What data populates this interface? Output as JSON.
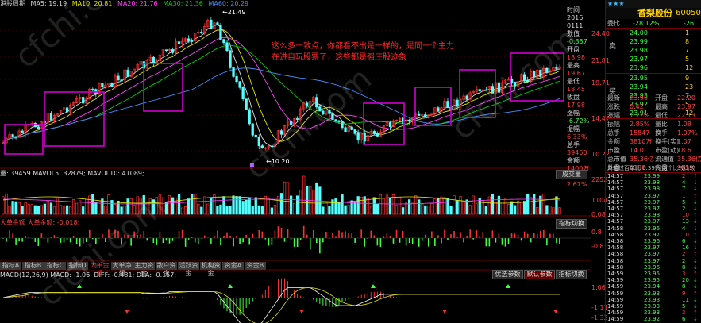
{
  "ma_legend": {
    "title": "港股周期",
    "items": [
      {
        "label": "MA5: 19.19",
        "color": "#dddddd"
      },
      {
        "label": "MA10: 20.81",
        "color": "#e8e800"
      },
      {
        "label": "MA20: 21.76",
        "color": "#ff40ff"
      },
      {
        "label": "MA30: 21.36",
        "color": "#00d000"
      },
      {
        "label": "MA60: 20.29",
        "color": "#4090ff"
      }
    ]
  },
  "price_labels": {
    "high": "21.49",
    "low": "10.20"
  },
  "annotation": {
    "line1": "这么多一致点，你都看不出是一样的，是同一个主力",
    "line2": "在进自玩股票了，这些都是强庄股迹象"
  },
  "watermark": "cfchi.com",
  "axis": {
    "price": [
      "24.40",
      "21.81",
      "19.71",
      "14.47",
      "10.22"
    ],
    "vol": [
      "2252",
      "1104",
      "",
      "0.08"
    ],
    "money": [
      "0.8",
      "-0.8"
    ],
    "macd": [
      "1.06",
      "-1.11",
      "-1.32"
    ]
  },
  "info_panel": {
    "items": [
      {
        "label": "时间",
        "value": "2016"
      },
      {
        "label": "",
        "value": "0111"
      },
      {
        "label": "数值",
        "value": "-0.357"
      },
      {
        "label": "开盘",
        "value": "18.98"
      },
      {
        "label": "最高",
        "value": "19.67"
      },
      {
        "label": "最低",
        "value": "18.45"
      },
      {
        "label": "收盘",
        "value": "17.98"
      },
      {
        "label": "涨幅",
        "value": "-6.72%"
      },
      {
        "label": "振幅",
        "value": "6.33%"
      },
      {
        "label": "总手",
        "value": "39460"
      },
      {
        "label": "金额",
        "value": "1400万"
      },
      {
        "label": "换手",
        "value": "2.67%"
      }
    ]
  },
  "vol_legend": {
    "text": "量: 39459  MAVOL5: 32879;  MAVOL10: 41089;",
    "btn": "成交量"
  },
  "money_legend": {
    "text": "大单金额  大单金额: -0.018;",
    "btn": "指标切换"
  },
  "macd_legend": {
    "text": "MACD(12,26,9)  MACD: -1.06;  DIFF: -0.481;  DEA: -0.157;"
  },
  "macd_buttons": [
    "优选参数",
    "默认参数",
    "指标切换"
  ],
  "tabs": [
    "指标A",
    "指标B",
    "指标C",
    "指标D",
    "大单金额",
    "大单净额",
    "主力资金",
    "散户资金",
    "活跃资金",
    "机构资金",
    "资金A",
    "资金B"
  ],
  "right_panel": {
    "stars": "★★★",
    "stock_name": "香梨股份",
    "stock_code": "600506",
    "committee": {
      "label": "委比",
      "value": "-28.12%",
      "diff": "-26"
    },
    "asks": [
      {
        "price": "24.00",
        "vol": "1"
      },
      {
        "price": "23.99",
        "vol": "8"
      },
      {
        "price": "23.98",
        "vol": "7"
      },
      {
        "price": "23.97",
        "vol": "5"
      },
      {
        "price": "23.96",
        "vol": "12"
      }
    ],
    "sell_label": "卖",
    "buy_label": "买",
    "bids": [
      {
        "price": "23.95",
        "vol": "9"
      },
      {
        "price": "23.94",
        "vol": "23"
      },
      {
        "price": "23.93",
        "vol": "7"
      },
      {
        "price": "23.92",
        "vol": "5"
      },
      {
        "price": "23.91",
        "vol": "12"
      }
    ],
    "stats": [
      {
        "l": "最新",
        "v": "23.96",
        "l2": "开盘",
        "v2": "22.20"
      },
      {
        "l": "涨跌",
        "v": "0.42",
        "l2": "最高",
        "v2": "23.97"
      },
      {
        "l": "涨幅",
        "v": "1.72%",
        "l2": "最低",
        "v2": "22.13"
      },
      {
        "l": "振幅",
        "v": "2.85%",
        "l2": "量比",
        "v2": "1.08"
      },
      {
        "l": "总手",
        "v": "15847",
        "l2": "换手",
        "v2": "1.07%"
      },
      {
        "l": "金额",
        "v": "3810万",
        "l2": "换手(实)",
        "v2": "1.07"
      },
      {
        "l": "市盈",
        "v": "14.0",
        "l2": "市盈(动)",
        "v2": "18.6"
      },
      {
        "l": "总市值",
        "v": "35.36亿",
        "l2": "流通值",
        "v2": "35.36亿"
      },
      {
        "l": "外盘",
        "v": "6188",
        "l2": "内盘",
        "v2": "9659"
      }
    ],
    "ticks_header": "单笔过百单比  0.39%  两个比较比较",
    "ticks": [
      {
        "t": "14:57",
        "p": "23.99",
        "v": "2"
      },
      {
        "t": "14:57",
        "p": "23.98",
        "v": "4"
      },
      {
        "t": "14:57",
        "p": "23.98",
        "v": "7"
      },
      {
        "t": "14:57",
        "p": "23.97",
        "v": "1"
      },
      {
        "t": "14:57",
        "p": "23.97",
        "v": "5"
      },
      {
        "t": "14:57",
        "p": "23.97",
        "v": "2"
      },
      {
        "t": "14:57",
        "p": "23.98",
        "v": "10"
      },
      {
        "t": "14:57",
        "p": "23.97",
        "v": "13"
      },
      {
        "t": "14:58",
        "p": "23.96",
        "v": "4"
      },
      {
        "t": "14:58",
        "p": "23.97",
        "v": "10"
      },
      {
        "t": "14:58",
        "p": "23.96",
        "v": "6"
      },
      {
        "t": "14:58",
        "p": "23.97",
        "v": "16"
      },
      {
        "t": "14:58",
        "p": "23.97",
        "v": "2"
      },
      {
        "t": "14:58",
        "p": "23.97",
        "v": "2"
      },
      {
        "t": "14:58",
        "p": "23.96",
        "v": "8"
      },
      {
        "t": "14:59",
        "p": "23.95",
        "v": "3"
      },
      {
        "t": "14:59",
        "p": "23.95",
        "v": "20"
      },
      {
        "t": "14:59",
        "p": "23.94",
        "v": "8"
      },
      {
        "t": "14:59",
        "p": "23.93",
        "v": "9"
      },
      {
        "t": "14:59",
        "p": "23.93",
        "v": "11"
      },
      {
        "t": "14:59",
        "p": "23.93",
        "v": "5"
      },
      {
        "t": "14:59",
        "p": "23.93",
        "v": "3"
      },
      {
        "t": "14:59",
        "p": "23.92",
        "v": "6"
      }
    ]
  },
  "colors": {
    "up": "#ff3030",
    "down": "#54ffff",
    "box": "#d000d0",
    "annotation": "#ff2a2a",
    "grid": "#6b0000"
  }
}
